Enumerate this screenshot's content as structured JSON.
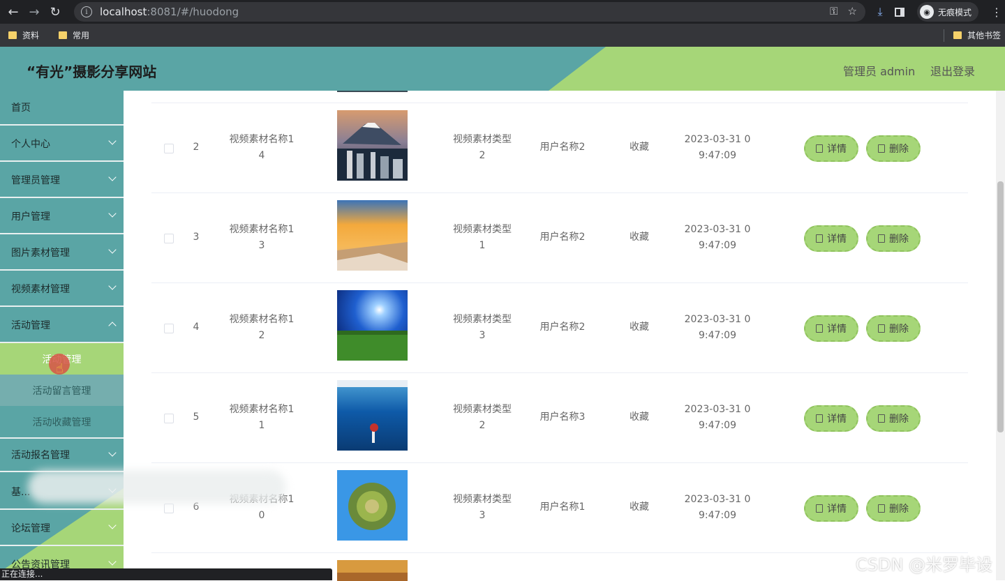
{
  "browser": {
    "url_host": "localhost",
    "url_rest": ":8081/#/huodong",
    "incognito_label": "无痕模式",
    "bookmarks": [
      "资料",
      "常用"
    ],
    "other_bookmarks": "其他书签",
    "status_text": "正在连接..."
  },
  "header": {
    "title": "“有光”摄影分享网站",
    "admin_label": "管理员 admin",
    "logout_label": "退出登录"
  },
  "sidebar": {
    "items": [
      {
        "label": "首页"
      },
      {
        "label": "个人中心"
      },
      {
        "label": "管理员管理"
      },
      {
        "label": "用户管理"
      },
      {
        "label": "图片素材管理"
      },
      {
        "label": "视频素材管理"
      },
      {
        "label": "活动管理"
      },
      {
        "label": "活动报名管理"
      },
      {
        "label": "基..."
      },
      {
        "label": "论坛管理"
      },
      {
        "label": "公告资讯管理"
      }
    ],
    "submenu": [
      {
        "label": "活动管理"
      },
      {
        "label": "活动留言管理"
      },
      {
        "label": "活动收藏管理"
      }
    ]
  },
  "table": {
    "detail_label": "详情",
    "delete_label": "删除",
    "rows": [
      {
        "index": "2",
        "name_1": "视频素材名称1",
        "name_2": "4",
        "type_1": "视频素材类型",
        "type_2": "2",
        "user": "用户名称2",
        "action": "收藏",
        "time_1": "2023-03-31 0",
        "time_2": "9:47:09",
        "thumb": "city-mountain"
      },
      {
        "index": "3",
        "name_1": "视频素材名称1",
        "name_2": "3",
        "type_1": "视频素材类型",
        "type_2": "1",
        "user": "用户名称2",
        "action": "收藏",
        "time_1": "2023-03-31 0",
        "time_2": "9:47:09",
        "thumb": "sunset-beach"
      },
      {
        "index": "4",
        "name_1": "视频素材名称1",
        "name_2": "2",
        "type_1": "视频素材类型",
        "type_2": "3",
        "user": "用户名称2",
        "action": "收藏",
        "time_1": "2023-03-31 0",
        "time_2": "9:47:09",
        "thumb": "green-field-sun"
      },
      {
        "index": "5",
        "name_1": "视频素材名称1",
        "name_2": "1",
        "type_1": "视频素材类型",
        "type_2": "2",
        "user": "用户名称3",
        "action": "收藏",
        "time_1": "2023-03-31 0",
        "time_2": "9:47:09",
        "thumb": "blue-sea-umbrella"
      },
      {
        "index": "6",
        "name_1": "视频素材名称1",
        "name_2": "0",
        "type_1": "视频素材类型",
        "type_2": "3",
        "user": "用户名称1",
        "action": "收藏",
        "time_1": "2023-03-31 0",
        "time_2": "9:47:09",
        "thumb": "tiny-planet"
      }
    ]
  },
  "watermark": "CSDN @米罗毕设",
  "colors": {
    "teal": "#5aa5a5",
    "green": "#a6d678"
  }
}
